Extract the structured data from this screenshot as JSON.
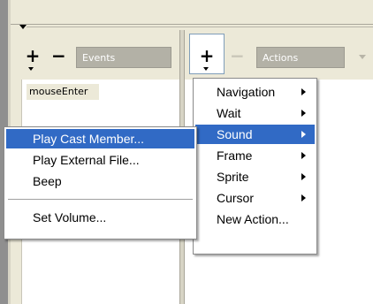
{
  "events": {
    "add_label": "+",
    "remove_label": "−",
    "field_label": "Events",
    "items": [
      "mouseEnter"
    ]
  },
  "actions": {
    "add_label": "+",
    "remove_label": "−",
    "field_label": "Actions"
  },
  "actions_menu": {
    "items": [
      {
        "label": "Navigation",
        "submenu": true
      },
      {
        "label": "Wait",
        "submenu": true
      },
      {
        "label": "Sound",
        "submenu": true,
        "selected": true
      },
      {
        "label": "Frame",
        "submenu": true
      },
      {
        "label": "Sprite",
        "submenu": true
      },
      {
        "label": "Cursor",
        "submenu": true
      },
      {
        "label": "New Action...",
        "submenu": false
      }
    ]
  },
  "sound_submenu": {
    "items": [
      {
        "label": "Play Cast Member...",
        "selected": true
      },
      {
        "label": "Play External File..."
      },
      {
        "label": "Beep"
      },
      {
        "label": "Set Volume..."
      }
    ]
  },
  "colors": {
    "panel_bg": "#ece9d8",
    "highlight": "#316ac5",
    "field_bg": "#b3b1a6"
  }
}
